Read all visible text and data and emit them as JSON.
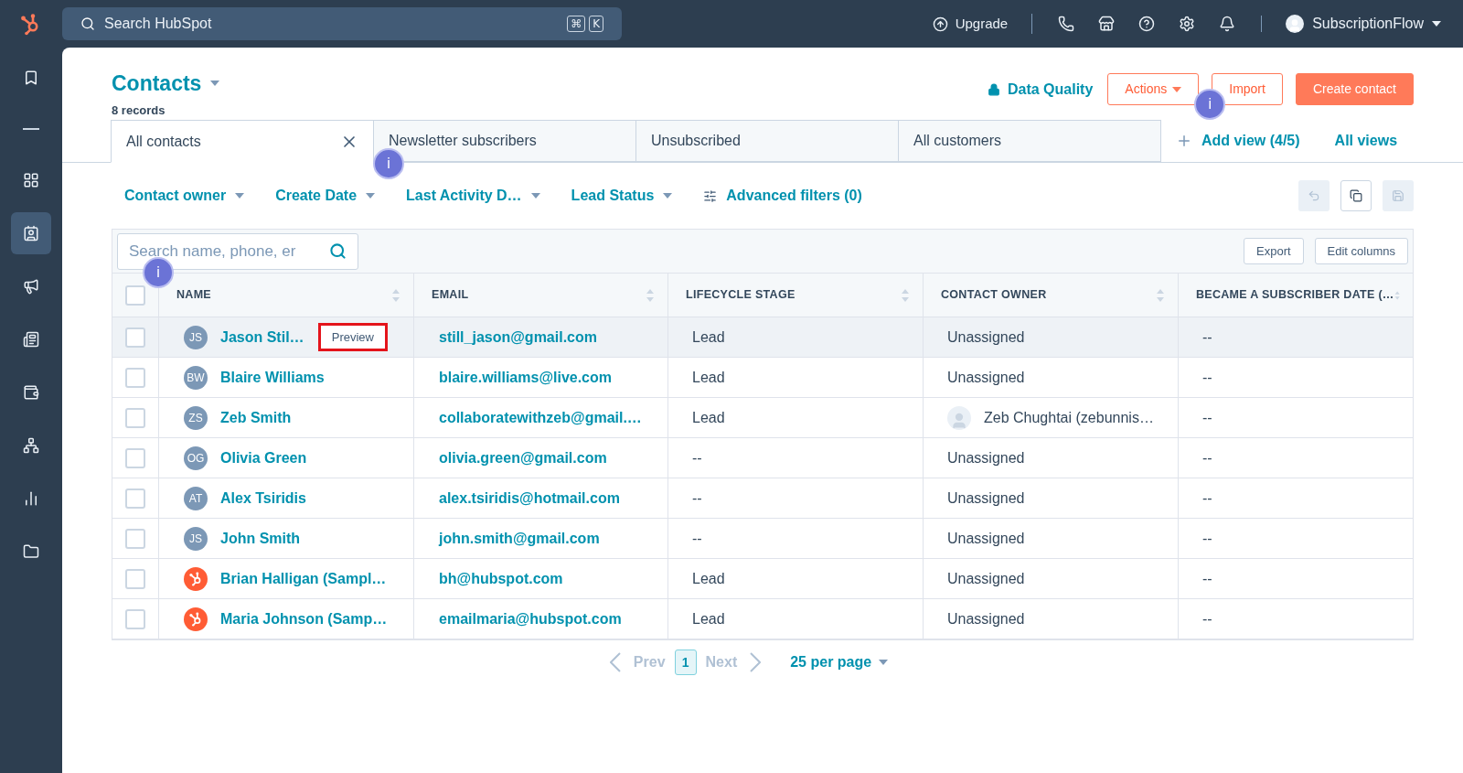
{
  "topbar": {
    "search": {
      "placeholder": "Search HubSpot",
      "keys": [
        "⌘",
        "K"
      ]
    },
    "upgrade": "Upgrade",
    "icons": [
      {
        "kind": "phone"
      },
      {
        "kind": "store"
      },
      {
        "kind": "help"
      },
      {
        "kind": "settings"
      },
      {
        "kind": "bell"
      }
    ],
    "account": "SubscriptionFlow"
  },
  "sidebar": {
    "items": [
      {
        "kind": "bookmark",
        "selected": false
      },
      {
        "kind": "divider",
        "selected": false
      },
      {
        "kind": "grid",
        "selected": false
      },
      {
        "kind": "contacts",
        "selected": true
      },
      {
        "kind": "megaphone",
        "selected": false
      },
      {
        "kind": "document",
        "selected": false
      },
      {
        "kind": "wallet",
        "selected": false
      },
      {
        "kind": "network",
        "selected": false
      },
      {
        "kind": "chart",
        "selected": false
      },
      {
        "kind": "folder",
        "selected": false
      }
    ]
  },
  "header": {
    "title": "Contacts",
    "subtitle": "8 records",
    "data_quality": "Data Quality",
    "buttons": [
      {
        "label": "Actions",
        "kind": "menu"
      },
      {
        "label": "Import",
        "kind": "outline",
        "marker": "i"
      },
      {
        "label": "Create contact",
        "kind": "primary"
      }
    ]
  },
  "tabs": [
    {
      "label": "All contacts",
      "selected": true
    },
    {
      "label": "Newsletter subscribers",
      "selected": false
    },
    {
      "label": "Unsubscribed",
      "selected": false
    },
    {
      "label": "All customers",
      "selected": false
    }
  ],
  "view_links": [
    {
      "label": "Add view (4/5)",
      "kind": "add"
    },
    {
      "label": "All views",
      "kind": "link"
    }
  ],
  "filters": [
    {
      "label": "Contact owner",
      "kind": "dropdown"
    },
    {
      "label": "Create Date",
      "kind": "dropdown",
      "marker": "i"
    },
    {
      "label": "Last Activity D…",
      "kind": "dropdown"
    },
    {
      "label": "Lead Status",
      "kind": "dropdown"
    },
    {
      "label": "Advanced filters (0)",
      "kind": "advanced"
    }
  ],
  "view_actions": [
    {
      "kind": "undo",
      "disabled": true
    },
    {
      "kind": "copy",
      "disabled": false
    },
    {
      "kind": "save",
      "disabled": true
    }
  ],
  "table": {
    "search": {
      "placeholder": "Search name, phone, er"
    },
    "buttons": [
      "Export",
      "Edit columns"
    ],
    "select_all": {
      "checked": false,
      "marker": "i"
    },
    "columns": [
      "NAME",
      "EMAIL",
      "LIFECYCLE STAGE",
      "CONTACT OWNER",
      "BECAME A SUBSCRIBER DATE (…"
    ],
    "rows": [
      {
        "checked": false,
        "hovered": true,
        "avatar": {
          "kind": "initials",
          "text": "JS"
        },
        "name": "Jason Stil…",
        "preview": {
          "label": "Preview",
          "highlighted": true
        },
        "email": "still_jason@gmail.com",
        "lifecycle": "Lead",
        "owner": {
          "name": "Unassigned",
          "avatar": false
        },
        "subscriber_date": "--"
      },
      {
        "checked": false,
        "hovered": false,
        "avatar": {
          "kind": "initials",
          "text": "BW"
        },
        "name": "Blaire Williams",
        "email": "blaire.williams@live.com",
        "lifecycle": "Lead",
        "owner": {
          "name": "Unassigned",
          "avatar": false
        },
        "subscriber_date": "--"
      },
      {
        "checked": false,
        "hovered": false,
        "avatar": {
          "kind": "initials",
          "text": "ZS"
        },
        "name": "Zeb Smith",
        "email": "collaboratewithzeb@gmail.…",
        "lifecycle": "Lead",
        "owner": {
          "name": "Zeb Chughtai (zebunnis…",
          "avatar": true
        },
        "subscriber_date": "--"
      },
      {
        "checked": false,
        "hovered": false,
        "avatar": {
          "kind": "initials",
          "text": "OG"
        },
        "name": "Olivia Green",
        "email": "olivia.green@gmail.com",
        "lifecycle": "--",
        "owner": {
          "name": "Unassigned",
          "avatar": false
        },
        "subscriber_date": "--"
      },
      {
        "checked": false,
        "hovered": false,
        "avatar": {
          "kind": "initials",
          "text": "AT"
        },
        "name": "Alex Tsiridis",
        "email": "alex.tsiridis@hotmail.com",
        "lifecycle": "--",
        "owner": {
          "name": "Unassigned",
          "avatar": false
        },
        "subscriber_date": "--"
      },
      {
        "checked": false,
        "hovered": false,
        "avatar": {
          "kind": "initials",
          "text": "JS"
        },
        "name": "John Smith",
        "email": "john.smith@gmail.com",
        "lifecycle": "--",
        "owner": {
          "name": "Unassigned",
          "avatar": false
        },
        "subscriber_date": "--"
      },
      {
        "checked": false,
        "hovered": false,
        "avatar": {
          "kind": "logo"
        },
        "name": "Brian Halligan (Sampl…",
        "email": "bh@hubspot.com",
        "lifecycle": "Lead",
        "owner": {
          "name": "Unassigned",
          "avatar": false
        },
        "subscriber_date": "--"
      },
      {
        "checked": false,
        "hovered": false,
        "avatar": {
          "kind": "logo"
        },
        "name": "Maria Johnson (Samp…",
        "email": "emailmaria@hubspot.com",
        "lifecycle": "Lead",
        "owner": {
          "name": "Unassigned",
          "avatar": false
        },
        "subscriber_date": "--"
      }
    ]
  },
  "pagination": {
    "prev": "Prev",
    "prev_disabled": true,
    "page": "1",
    "next": "Next",
    "next_disabled": true,
    "per_page": "25 per page"
  }
}
